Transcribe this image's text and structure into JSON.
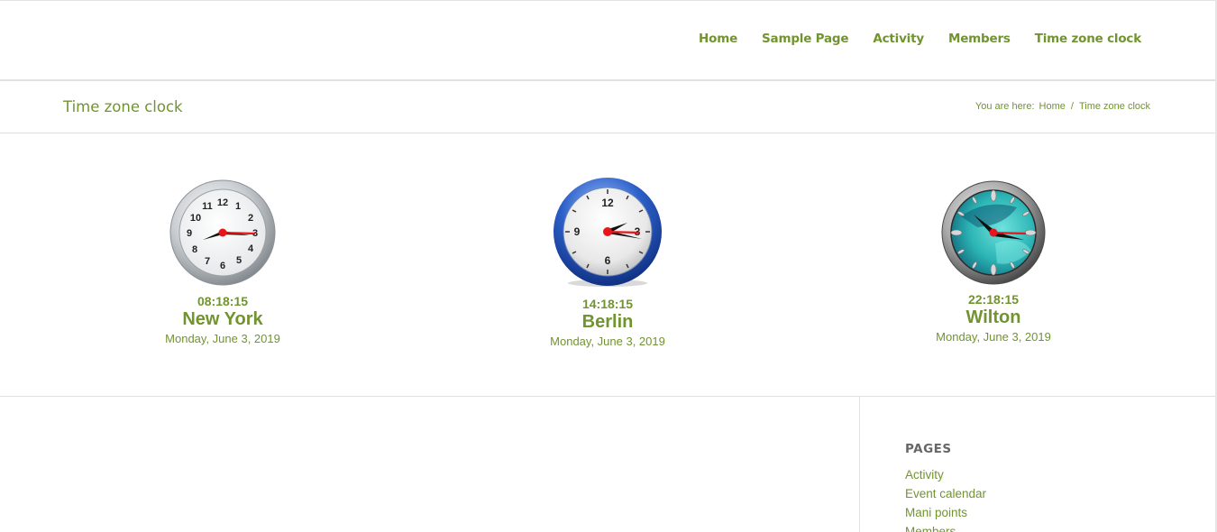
{
  "nav": {
    "items": [
      "Home",
      "Sample Page",
      "Activity",
      "Members",
      "Time zone clock"
    ]
  },
  "page": {
    "title": "Time zone clock"
  },
  "breadcrumb": {
    "prefix": "You are here:",
    "home": "Home",
    "separator": "/",
    "current": "Time zone clock"
  },
  "clocks": [
    {
      "time": "08:18:15",
      "city": "New York",
      "date": "Monday, June 3, 2019",
      "style": "silver"
    },
    {
      "time": "14:18:15",
      "city": "Berlin",
      "date": "Monday, June 3, 2019",
      "style": "blue"
    },
    {
      "time": "22:18:15",
      "city": "Wilton",
      "date": "Monday, June 3, 2019",
      "style": "teal"
    }
  ],
  "sidebar": {
    "heading": "PAGES",
    "items": [
      "Activity",
      "Event calendar",
      "Mani points",
      "Members"
    ]
  },
  "colors": {
    "accent": "#719430",
    "heading_gray": "#666666",
    "border": "#e1e1e1",
    "second_hand": "#e8161b"
  }
}
